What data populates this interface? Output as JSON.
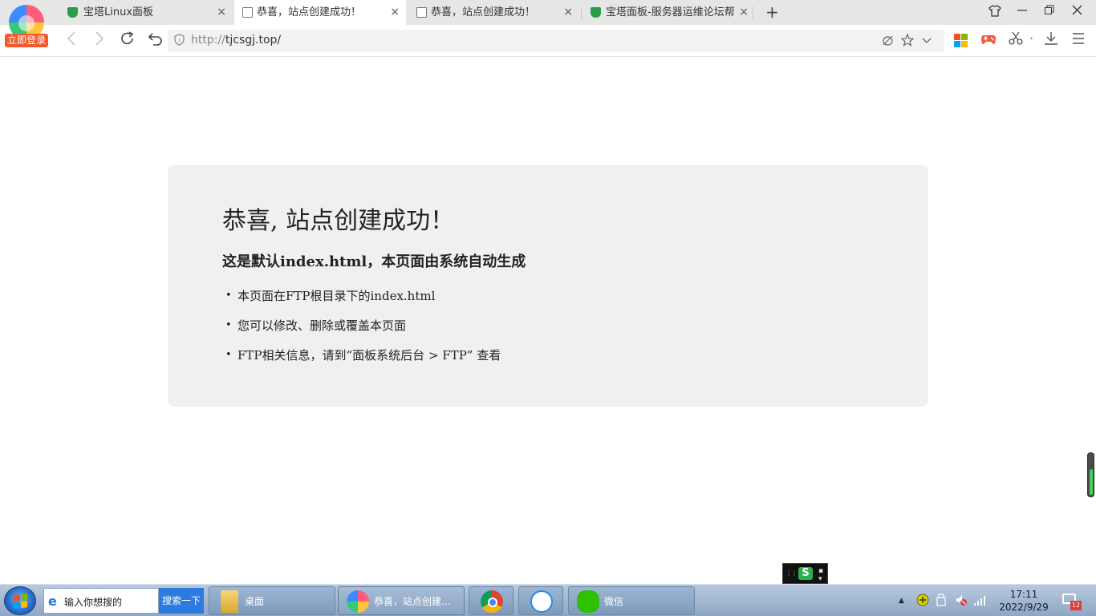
{
  "browser": {
    "login_badge": "立即登录",
    "tabs": [
      {
        "title": "宝塔Linux面板",
        "icon": "shield-icon",
        "close": "×"
      },
      {
        "title": "恭喜，站点创建成功！",
        "icon": "document-icon",
        "close": "×"
      },
      {
        "title": "恭喜，站点创建成功！",
        "icon": "document-icon",
        "close": "×"
      },
      {
        "title": "宝塔面板-服务器运维论坛帮你",
        "icon": "shield-icon",
        "close": "×"
      }
    ],
    "new_tab": "+",
    "address": {
      "protocol": "http://",
      "host": "tjcsgj.top/"
    }
  },
  "page": {
    "heading": "恭喜, 站点创建成功！",
    "subheading": "这是默认index.html，本页面由系统自动生成",
    "items": [
      "本页面在FTP根目录下的index.html",
      "您可以修改、删除或覆盖本页面",
      "FTP相关信息，请到“面板系统后台 > FTP” 查看"
    ]
  },
  "taskbar": {
    "search_placeholder": "输入你想搜的",
    "search_button": "搜索一下",
    "tasks": [
      {
        "label": "桌面",
        "icon": "folder-icon"
      },
      {
        "label": "恭喜，站点创建...",
        "icon": "browser-icon"
      },
      {
        "label": "",
        "icon": "chrome-icon"
      },
      {
        "label": "",
        "icon": "baidu-netdisk-icon"
      },
      {
        "label": "微信",
        "icon": "wechat-icon"
      }
    ],
    "clock": {
      "time": "17:11",
      "date": "2022/9/29"
    },
    "notification_count": "12"
  },
  "colors": {
    "tab_bar": "#e6e6e6",
    "card_background": "#f0f0f0",
    "login_badge": "#f05a30",
    "safe_shield": "#2a9d49",
    "taskbar": "#8ea7c4",
    "search_button": "#2b7be0"
  }
}
